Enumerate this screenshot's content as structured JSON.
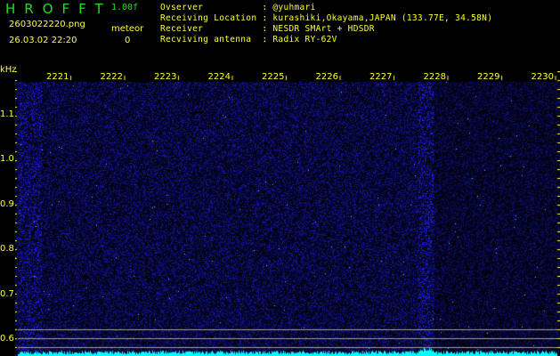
{
  "header": {
    "app_title": "HROFFT",
    "version": "1.00f",
    "filename": "2603022220.png",
    "datetime": "26.03.02 22:20",
    "meteor_label": "meteor",
    "meteor_count": "0"
  },
  "info": [
    {
      "label": "Ovserver           : @yuhmari"
    },
    {
      "label": "Receiving Location : kurashiki,Okayama,JAPAN (133.77E, 34.58N)"
    },
    {
      "label": "Receiver           : NESDR SMArt + HDSDR"
    },
    {
      "label": "Recviving antenna  : Radix RY-62V"
    }
  ],
  "axes": {
    "y_unit": "kHz",
    "x_ticks": [
      "2221",
      "2222",
      "2223",
      "2224",
      "2225",
      "2226",
      "2227",
      "2228",
      "2229",
      "2230"
    ],
    "y_ticks": [
      "1.1",
      "1.0",
      "0.9",
      "0.8",
      "0.7",
      "0.6"
    ]
  },
  "colors": {
    "background": "#000000",
    "label": "#ffff33",
    "title": "#22dd22",
    "noise": "#2020c0",
    "spectrum": "#00ffff"
  }
}
